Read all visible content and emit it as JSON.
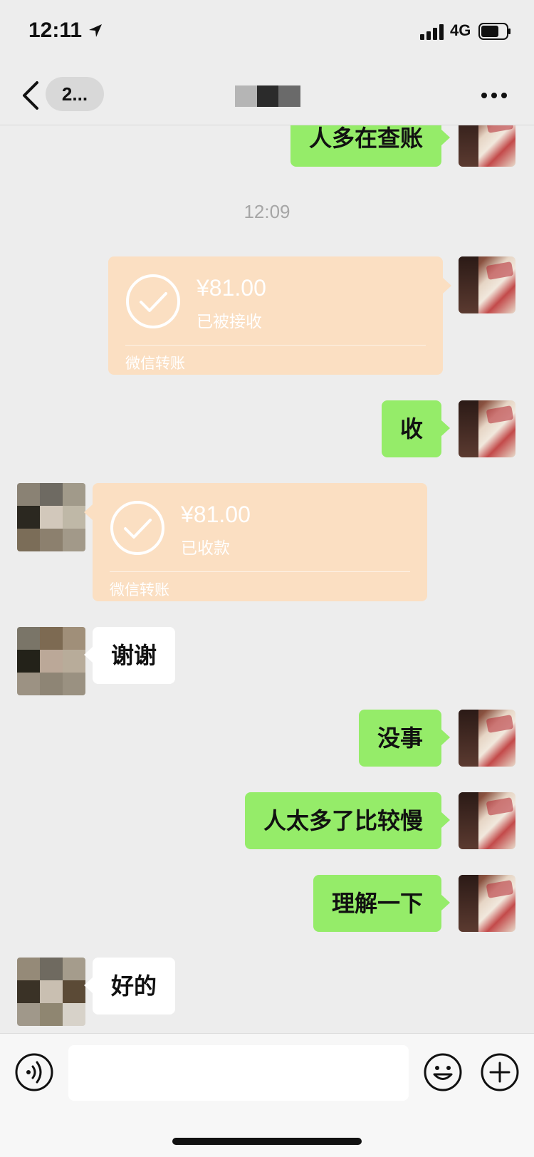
{
  "status_bar": {
    "time": "12:11",
    "network": "4G"
  },
  "nav": {
    "unread_count": "2..."
  },
  "messages": {
    "m1": "人多在查账",
    "timestamp": "12:09",
    "transfer1": {
      "amount": "¥81.00",
      "status": "已被接收",
      "label": "微信转账"
    },
    "m2": "收",
    "transfer2": {
      "amount": "¥81.00",
      "status": "已收款",
      "label": "微信转账"
    },
    "m3": "谢谢",
    "m4": "没事",
    "m5": "人太多了比较慢",
    "m6": "理解一下",
    "m7": "好的"
  },
  "colors": {
    "self_bubble": "#95ec69",
    "other_bubble": "#ffffff",
    "transfer": "#fbdfc2",
    "background": "#ededed"
  }
}
